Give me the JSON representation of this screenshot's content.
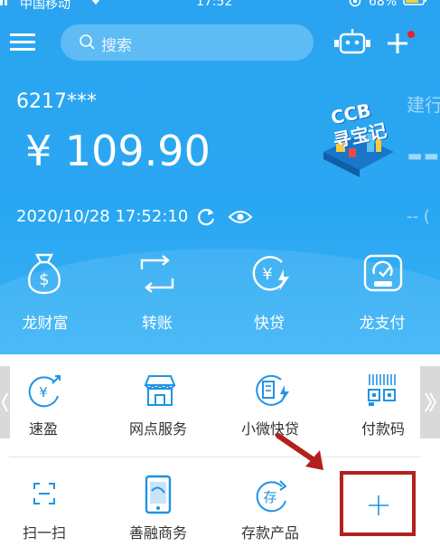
{
  "status_bar": {
    "carrier": "中国移动",
    "time": "17:52",
    "battery": "68%"
  },
  "header": {
    "search_placeholder": "搜索"
  },
  "account": {
    "card_number": "6217***",
    "balance": "¥ 109.90",
    "timestamp": "2020/10/28 17:52:10",
    "right_title": "建行",
    "right_value": "--",
    "right_small": "-- ("
  },
  "promo": {
    "title_line1": "CCB",
    "title_line2": "寻宝记"
  },
  "quick_actions": [
    {
      "label": "龙财富",
      "icon": "money-bag-icon"
    },
    {
      "label": "转账",
      "icon": "transfer-icon"
    },
    {
      "label": "快贷",
      "icon": "fast-loan-icon"
    },
    {
      "label": "龙支付",
      "icon": "long-pay-icon"
    }
  ],
  "services_row1": [
    {
      "label": "速盈",
      "icon": "yuan-growth-icon"
    },
    {
      "label": "网点服务",
      "icon": "branch-icon"
    },
    {
      "label": "小微快贷",
      "icon": "building-loan-icon"
    },
    {
      "label": "付款码",
      "icon": "payment-code-icon"
    }
  ],
  "services_row2": [
    {
      "label": "扫一扫",
      "icon": "scan-icon"
    },
    {
      "label": "善融商务",
      "icon": "phone-shop-icon"
    },
    {
      "label": "存款产品",
      "icon": "deposit-icon"
    }
  ],
  "colors": {
    "primary": "#2aa4f0",
    "accent_icon": "#1f93e4",
    "highlight_box": "#b3201d"
  }
}
